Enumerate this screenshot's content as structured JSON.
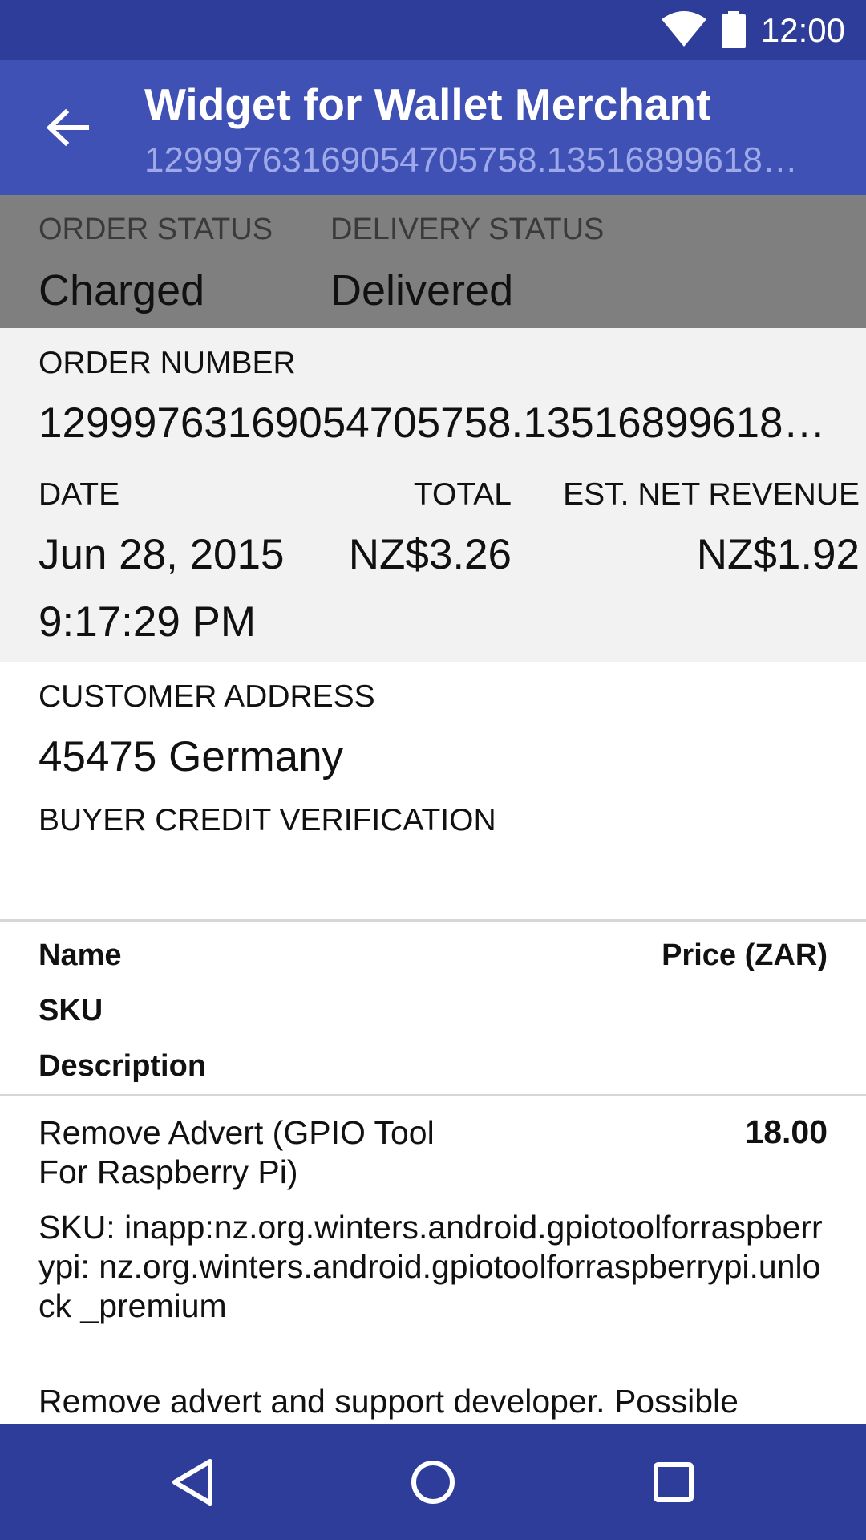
{
  "status_bar": {
    "time": "12:00",
    "icons": [
      "wifi-icon",
      "battery-icon"
    ]
  },
  "app_bar": {
    "title": "Widget for Wallet Merchant",
    "subtitle": "12999763169054705758.13516899618…",
    "back_icon": "arrow-back-icon"
  },
  "order_status": {
    "order_label": "ORDER STATUS",
    "order_value": "Charged",
    "delivery_label": "DELIVERY STATUS",
    "delivery_value": "Delivered"
  },
  "order": {
    "number_label": "ORDER NUMBER",
    "number_value": "12999763169054705758.13516899618…",
    "date_label": "DATE",
    "date_value": "Jun 28, 2015",
    "time_value": "9:17:29 PM",
    "total_label": "TOTAL",
    "total_value": "NZ$3.26",
    "revenue_label": "EST. NET REVENUE",
    "revenue_value": "NZ$1.92"
  },
  "customer": {
    "address_label": "CUSTOMER ADDRESS",
    "address_value": "45475 Germany",
    "credit_label": "BUYER CREDIT VERIFICATION"
  },
  "items_header": {
    "name": "Name",
    "price": "Price (ZAR)",
    "sku": "SKU",
    "description": "Description"
  },
  "items": [
    {
      "name": "Remove Advert (GPIO Tool For Raspberry Pi)",
      "price": "18.00",
      "sku": "SKU: inapp:nz.org.winters.android.gpiotoolforraspberrypi: nz.org.winters.android.gpiotoolforraspberrypi.unlock _premium",
      "description": "Remove advert and support developer. Possible"
    }
  ],
  "nav_bar": {
    "icons": [
      "back-nav-icon",
      "home-nav-icon",
      "recents-nav-icon"
    ]
  }
}
